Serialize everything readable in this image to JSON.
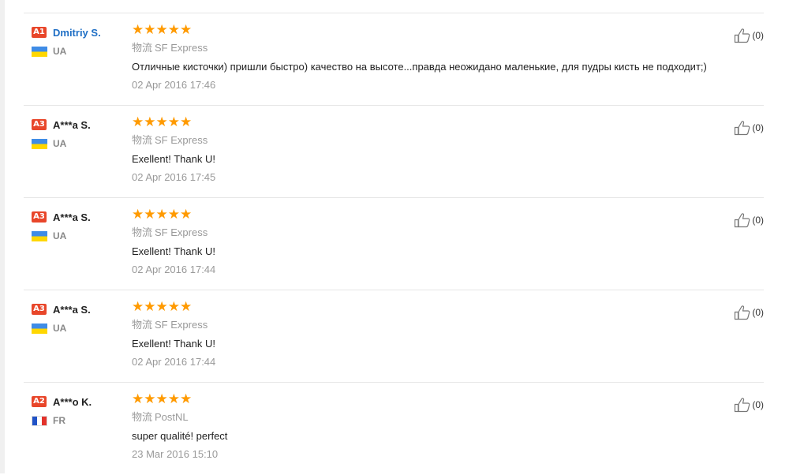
{
  "logistics_prefix": "物流",
  "colors": {
    "star": "#ff9a00",
    "level_badge": "#e8462a",
    "link_name": "#1f6fc5"
  },
  "reviews": [
    {
      "level": "A1",
      "name": "Dmitriy S.",
      "country": "UA",
      "rating": 5,
      "logistics": "SF Express",
      "text": "Отличные кисточки) пришли быстро) качество на высоте...правда неожидано маленькие, для пудры кисть не подходит;)",
      "date": "02 Apr 2016 17:46",
      "helpful_count": "(0)"
    },
    {
      "level": "A3",
      "name": "A***a S.",
      "country": "UA",
      "rating": 5,
      "logistics": "SF Express",
      "text": "Exellent! Thank U!",
      "date": "02 Apr 2016 17:45",
      "helpful_count": "(0)"
    },
    {
      "level": "A3",
      "name": "A***a S.",
      "country": "UA",
      "rating": 5,
      "logistics": "SF Express",
      "text": "Exellent! Thank U!",
      "date": "02 Apr 2016 17:44",
      "helpful_count": "(0)"
    },
    {
      "level": "A3",
      "name": "A***a S.",
      "country": "UA",
      "rating": 5,
      "logistics": "SF Express",
      "text": "Exellent! Thank U!",
      "date": "02 Apr 2016 17:44",
      "helpful_count": "(0)"
    },
    {
      "level": "A2",
      "name": "A***o K.",
      "country": "FR",
      "rating": 5,
      "logistics": "PostNL",
      "text": "super qualité! perfect",
      "date": "23 Mar 2016 15:10",
      "helpful_count": "(0)"
    }
  ]
}
